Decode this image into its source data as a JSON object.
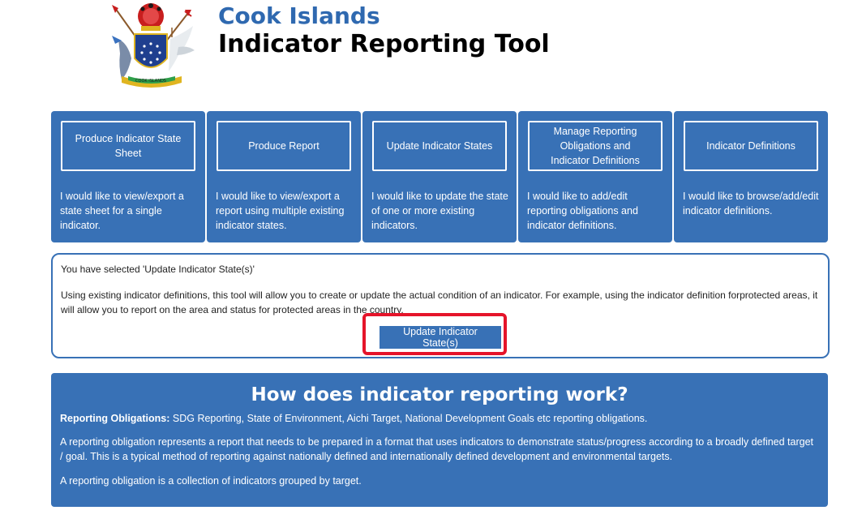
{
  "header": {
    "title_small": "Cook Islands",
    "title_large": "Indicator Reporting Tool",
    "logo_icon": "cook-islands-coat-of-arms",
    "logo_banner_text": "COOK ISLANDS"
  },
  "cards": [
    {
      "button": "Produce Indicator State Sheet",
      "description": "I would like to view/export a state sheet for a single indicator."
    },
    {
      "button": "Produce Report",
      "description": "I would like to view/export a report using multiple existing indicator states."
    },
    {
      "button": "Update Indicator States",
      "description": "I would like to update the state of one or more existing indicators."
    },
    {
      "button": "Manage Reporting Obligations and Indicator Definitions",
      "description": "I would like to add/edit reporting obligations and indicator definitions."
    },
    {
      "button": "Indicator Definitions",
      "description": "I would like to browse/add/edit indicator definitions."
    }
  ],
  "selected": {
    "line": "You have selected 'Update Indicator State(s)'",
    "description": "Using existing indicator definitions, this tool will allow you to create or update the actual condition of an indicator. For example, using the indicator definition forprotected areas, it will allow you to report on the area and status for protected areas in the country.",
    "button": "Update Indicator State(s)"
  },
  "how": {
    "title": "How does indicator reporting work?",
    "obligations_label": "Reporting Obligations:",
    "obligations_text": " SDG Reporting, State of Environment, Aichi Target, National Development Goals etc reporting obligations.",
    "para1": "A reporting obligation represents a report that needs to be prepared in a format that uses indicators to demonstrate status/progress according to a broadly defined target / goal. This is a typical method of reporting against nationally defined and internationally defined development and environmental targets.",
    "para2": "A reporting obligation is a collection of indicators grouped by target."
  },
  "colors": {
    "brand_blue": "#3871b6",
    "title_blue": "#2f69b0",
    "annotation_red": "#e5142a"
  }
}
